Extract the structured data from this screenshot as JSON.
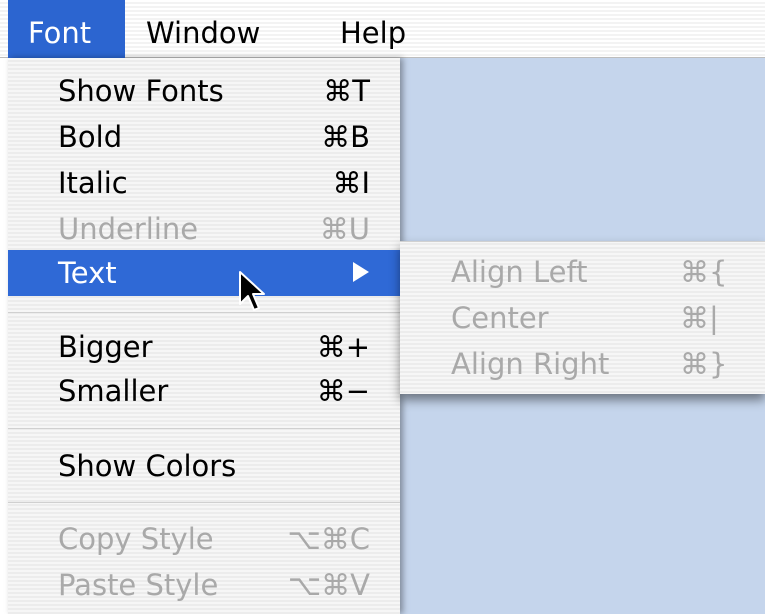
{
  "menubar": {
    "items": [
      {
        "label": "Font",
        "active": true
      },
      {
        "label": "Window",
        "active": false
      },
      {
        "label": "Help",
        "active": false
      }
    ]
  },
  "font_menu": {
    "items": [
      {
        "label": "Show Fonts",
        "shortcut": "⌘T",
        "enabled": true
      },
      {
        "label": "Bold",
        "shortcut": "⌘B",
        "enabled": true
      },
      {
        "label": "Italic",
        "shortcut": "⌘I",
        "enabled": true
      },
      {
        "label": "Underline",
        "shortcut": "⌘U",
        "enabled": false
      },
      {
        "label": "Text",
        "shortcut": "",
        "enabled": true,
        "selected": true,
        "has_submenu": true
      },
      {
        "label": "Bigger",
        "shortcut": "⌘+",
        "enabled": true
      },
      {
        "label": "Smaller",
        "shortcut": "⌘−",
        "enabled": true
      },
      {
        "label": "Show Colors",
        "shortcut": "",
        "enabled": true
      },
      {
        "label": "Copy Style",
        "shortcut": "⌥⌘C",
        "enabled": false
      },
      {
        "label": "Paste Style",
        "shortcut": "⌥⌘V",
        "enabled": false
      }
    ]
  },
  "text_submenu": {
    "items": [
      {
        "label": "Align Left",
        "shortcut": "⌘{",
        "enabled": false
      },
      {
        "label": "Center",
        "shortcut": "⌘|",
        "enabled": false
      },
      {
        "label": "Align Right",
        "shortcut": "⌘}",
        "enabled": false
      }
    ]
  },
  "colors": {
    "highlight": "#2f69d6",
    "desktop": "#c5d5ec",
    "disabled_text": "#a9a9a9"
  }
}
